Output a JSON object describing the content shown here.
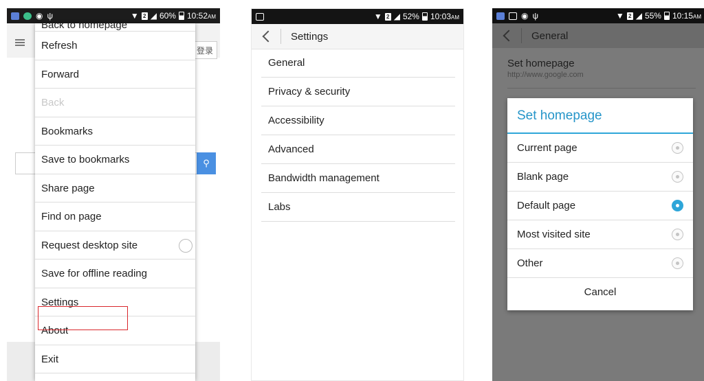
{
  "phone1": {
    "status": {
      "battery": "60%",
      "time": "10:52",
      "ampm": "AM"
    },
    "login_label": "登录",
    "search_icon": "magnifier",
    "menu_items": [
      {
        "label": "Back to homepage",
        "disabled": false
      },
      {
        "label": "Refresh",
        "disabled": false
      },
      {
        "label": "Forward",
        "disabled": false
      },
      {
        "label": "Back",
        "disabled": true
      },
      {
        "label": "Bookmarks",
        "disabled": false
      },
      {
        "label": "Save to bookmarks",
        "disabled": false
      },
      {
        "label": "Share page",
        "disabled": false
      },
      {
        "label": "Find on page",
        "disabled": false
      },
      {
        "label": "Request desktop site",
        "disabled": false
      },
      {
        "label": "Save for offline reading",
        "disabled": false
      },
      {
        "label": "Settings",
        "disabled": false
      },
      {
        "label": "About",
        "disabled": false
      },
      {
        "label": "Exit",
        "disabled": false
      }
    ],
    "highlight_color": "#d9262b"
  },
  "phone2": {
    "status": {
      "battery": "52%",
      "time": "10:03",
      "ampm": "AM"
    },
    "title": "Settings",
    "rows": [
      "General",
      "Privacy & security",
      "Accessibility",
      "Advanced",
      "Bandwidth management",
      "Labs"
    ]
  },
  "phone3": {
    "status": {
      "battery": "55%",
      "time": "10:15",
      "ampm": "AM"
    },
    "title": "General",
    "set_homepage": {
      "label": "Set homepage",
      "url": "http://www.google.com"
    },
    "dialog": {
      "title": "Set homepage",
      "options": [
        "Current page",
        "Blank page",
        "Default page",
        "Most visited site",
        "Other"
      ],
      "selected": "Default page",
      "cancel": "Cancel",
      "accent": "#2ea6d9"
    }
  }
}
